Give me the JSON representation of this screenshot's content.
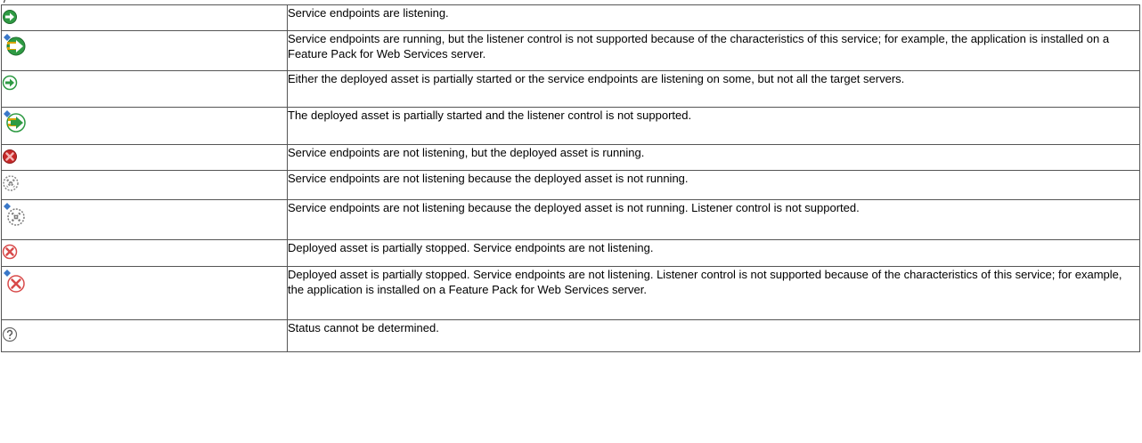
{
  "page": {
    "top_fragment": "/"
  },
  "rows": [
    {
      "icon": "listening-icon",
      "description": "Service endpoints are listening."
    },
    {
      "icon": "running-listener-unsupported-icon",
      "description": "Service endpoints are running, but the listener control is not supported because of the characteristics of this service; for example, the application is installed on a Feature Pack for Web Services server."
    },
    {
      "icon": "partially-listening-icon",
      "description": "Either the deployed asset is partially started or the service endpoints are listening on some, but not all the target servers."
    },
    {
      "icon": "partially-started-listener-unsupported-icon",
      "description": "The deployed asset is partially started and the listener control is not supported."
    },
    {
      "icon": "not-listening-running-icon",
      "description": "Service endpoints are not listening, but the deployed asset is running."
    },
    {
      "icon": "not-listening-not-running-icon",
      "description": "Service endpoints are not listening because the deployed asset is not running."
    },
    {
      "icon": "not-listening-not-running-listener-unsupported-icon",
      "description": "Service endpoints are not listening because the deployed asset is not running. Listener control is not supported."
    },
    {
      "icon": "partially-stopped-icon",
      "description": "Deployed asset is partially stopped. Service endpoints are not listening."
    },
    {
      "icon": "partially-stopped-listener-unsupported-icon",
      "description": "Deployed asset is partially stopped. Service endpoints are not listening. Listener control is not supported because of the characteristics of this service; for example, the application is installed on a Feature Pack for Web Services server."
    },
    {
      "icon": "status-unknown-icon",
      "description": "Status cannot be determined."
    }
  ],
  "colors": {
    "listening_green": "#2e9a43",
    "stopped_red": "#c62828",
    "partial_red": "#d84a4a",
    "neutral_gray": "#8a8a8a",
    "badge_blue": "#3a78c9"
  }
}
